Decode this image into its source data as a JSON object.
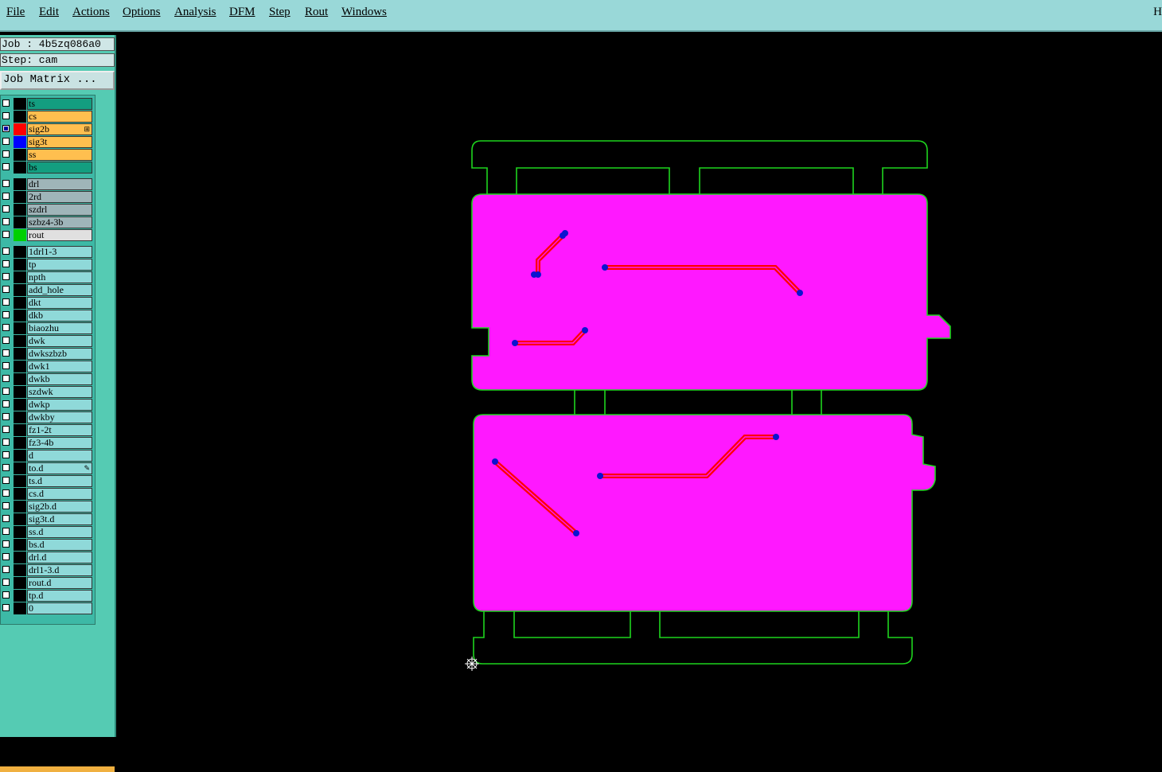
{
  "menubar": {
    "items": [
      "File",
      "Edit",
      "Actions",
      "Options",
      "Analysis",
      "DFM",
      "Step",
      "Rout",
      "Windows"
    ],
    "help": "H"
  },
  "panel": {
    "job_label": "Job : 4b5zq086a0",
    "step_label": "Step: cam",
    "job_matrix": "Job Matrix ..."
  },
  "layers": [
    {
      "name": "ts",
      "bg": "#139e80",
      "swatch": "#000000",
      "active": false
    },
    {
      "name": "cs",
      "bg": "#ffbf4f",
      "swatch": "#000000",
      "active": false
    },
    {
      "name": "sig2b",
      "bg": "#ffbf4f",
      "swatch": "#ff0000",
      "active": true,
      "mark": "⊞"
    },
    {
      "name": "sig3t",
      "bg": "#ffbf4f",
      "swatch": "#0000ff",
      "active": false
    },
    {
      "name": "ss",
      "bg": "#ffbf4f",
      "swatch": "#000000",
      "active": false
    },
    {
      "name": "bs",
      "bg": "#139e80",
      "swatch": "#000000",
      "active": false
    },
    {
      "name": "drl",
      "bg": "#9fb5b9",
      "swatch": "#000000",
      "active": false
    },
    {
      "name": "2rd",
      "bg": "#9fb5b9",
      "swatch": "#000000",
      "active": false
    },
    {
      "name": "szdrl",
      "bg": "#9fb5b9",
      "swatch": "#000000",
      "active": false
    },
    {
      "name": "szbz4-3b",
      "bg": "#9fb5b9",
      "swatch": "#000000",
      "active": false
    },
    {
      "name": "rout",
      "bg": "#e0e0e0",
      "swatch": "#00d000",
      "active": false
    },
    {
      "name": "1drl1-3",
      "bg": "#8fd9d9",
      "swatch": "#000000",
      "active": false
    },
    {
      "name": "tp",
      "bg": "#8fd9d9",
      "swatch": "#000000",
      "active": false
    },
    {
      "name": "npth",
      "bg": "#8fd9d9",
      "swatch": "#000000",
      "active": false
    },
    {
      "name": "add_hole",
      "bg": "#8fd9d9",
      "swatch": "#000000",
      "active": false
    },
    {
      "name": "dkt",
      "bg": "#8fd9d9",
      "swatch": "#000000",
      "active": false
    },
    {
      "name": "dkb",
      "bg": "#8fd9d9",
      "swatch": "#000000",
      "active": false
    },
    {
      "name": "biaozhu",
      "bg": "#8fd9d9",
      "swatch": "#000000",
      "active": false
    },
    {
      "name": "dwk",
      "bg": "#8fd9d9",
      "swatch": "#000000",
      "active": false
    },
    {
      "name": "dwkszbzb",
      "bg": "#8fd9d9",
      "swatch": "#000000",
      "active": false
    },
    {
      "name": "dwk1",
      "bg": "#8fd9d9",
      "swatch": "#000000",
      "active": false
    },
    {
      "name": "dwkb",
      "bg": "#8fd9d9",
      "swatch": "#000000",
      "active": false
    },
    {
      "name": "szdwk",
      "bg": "#8fd9d9",
      "swatch": "#000000",
      "active": false
    },
    {
      "name": "dwkp",
      "bg": "#8fd9d9",
      "swatch": "#000000",
      "active": false
    },
    {
      "name": "dwkby",
      "bg": "#8fd9d9",
      "swatch": "#000000",
      "active": false
    },
    {
      "name": "fz1-2t",
      "bg": "#8fd9d9",
      "swatch": "#000000",
      "active": false
    },
    {
      "name": "fz3-4b",
      "bg": "#8fd9d9",
      "swatch": "#000000",
      "active": false
    },
    {
      "name": "d",
      "bg": "#8fd9d9",
      "swatch": "#000000",
      "active": false
    },
    {
      "name": "to.d",
      "bg": "#8fd9d9",
      "swatch": "#000000",
      "active": false,
      "mark": "✎"
    },
    {
      "name": "ts.d",
      "bg": "#8fd9d9",
      "swatch": "#000000",
      "active": false
    },
    {
      "name": "cs.d",
      "bg": "#8fd9d9",
      "swatch": "#000000",
      "active": false
    },
    {
      "name": "sig2b.d",
      "bg": "#8fd9d9",
      "swatch": "#000000",
      "active": false
    },
    {
      "name": "sig3t.d",
      "bg": "#8fd9d9",
      "swatch": "#000000",
      "active": false
    },
    {
      "name": "ss.d",
      "bg": "#8fd9d9",
      "swatch": "#000000",
      "active": false
    },
    {
      "name": "bs.d",
      "bg": "#8fd9d9",
      "swatch": "#000000",
      "active": false
    },
    {
      "name": "drl.d",
      "bg": "#8fd9d9",
      "swatch": "#000000",
      "active": false
    },
    {
      "name": "drl1-3.d",
      "bg": "#8fd9d9",
      "swatch": "#000000",
      "active": false
    },
    {
      "name": "rout.d",
      "bg": "#8fd9d9",
      "swatch": "#000000",
      "active": false
    },
    {
      "name": "tp.d",
      "bg": "#8fd9d9",
      "swatch": "#000000",
      "active": false
    },
    {
      "name": "0",
      "bg": "#8fd9d9",
      "swatch": "#000000",
      "active": false
    }
  ],
  "colors": {
    "board_fill": "#ff18ff",
    "outline": "#1ed41e",
    "trace": "#ff0000",
    "pad": "#0a14d0"
  }
}
